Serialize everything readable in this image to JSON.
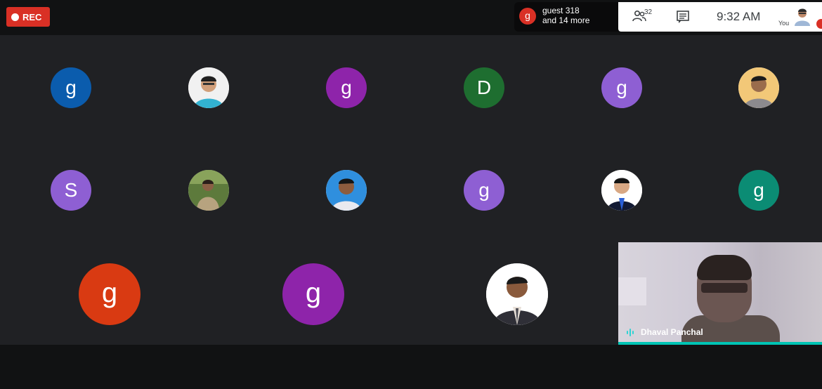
{
  "recording": {
    "label": "REC"
  },
  "speakers": {
    "avatar_letter": "g",
    "line1": "guest 318",
    "line2": "and 14 more"
  },
  "toolbar": {
    "participant_count": "32",
    "time": "9:32 AM",
    "self_label": "You"
  },
  "grid": {
    "row1": [
      {
        "letter": "g",
        "color": "#0b5cad"
      },
      {
        "photo": "participant-photo"
      },
      {
        "letter": "g",
        "color": "#8e24aa"
      },
      {
        "letter": "D",
        "color": "#1e6e30"
      },
      {
        "letter": "g",
        "color": "#8e5fd3"
      },
      {
        "photo": "participant-photo"
      }
    ],
    "row2": [
      {
        "letter": "S",
        "color": "#8e5fd3"
      },
      {
        "photo": "participant-photo"
      },
      {
        "photo": "participant-photo"
      },
      {
        "letter": "g",
        "color": "#8e5fd3"
      },
      {
        "photo": "participant-photo"
      },
      {
        "letter": "g",
        "color": "#0b8c74"
      }
    ],
    "row3": [
      {
        "letter": "g",
        "color": "#d93a12"
      },
      {
        "letter": "g",
        "color": "#8e24aa"
      },
      {
        "photo": "participant-photo"
      }
    ]
  },
  "video": {
    "name": "Dhaval Panchal"
  },
  "colors": {
    "accent": "#00c4b4",
    "rec": "#d93025"
  }
}
